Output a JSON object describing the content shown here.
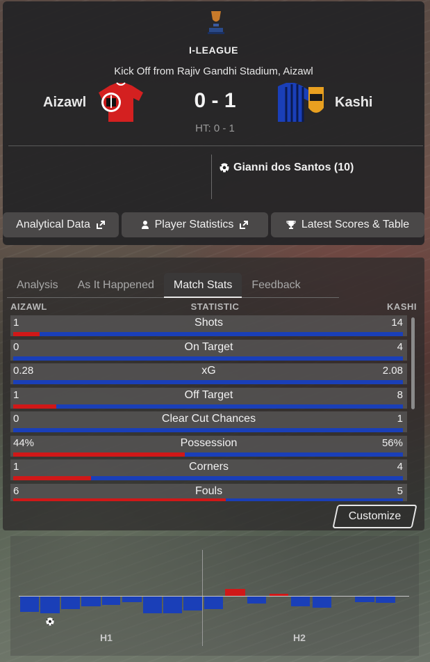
{
  "header": {
    "league": "I-LEAGUE",
    "kickoff": "Kick Off from Rajiv Gandhi Stadium, Aizawl",
    "home_team": "Aizawl",
    "away_team": "Kashi",
    "score": "0 - 1",
    "half_time": "HT: 0 - 1",
    "scorer": "Gianni dos Santos (10)",
    "home_color": "#d01818",
    "away_color": "#1a3fb8"
  },
  "buttons": {
    "analytical": "Analytical Data",
    "player_stats": "Player Statistics",
    "latest_scores": "Latest Scores & Table"
  },
  "tabs": [
    "Analysis",
    "As It Happened",
    "Match Stats",
    "Feedback"
  ],
  "active_tab": "Match Stats",
  "columns": {
    "home": "AIZAWL",
    "stat": "STATISTIC",
    "away": "KASHI"
  },
  "stats": [
    {
      "label": "Shots",
      "home": "1",
      "away": "14",
      "home_share": 0.067
    },
    {
      "label": "On Target",
      "home": "0",
      "away": "4",
      "home_share": 0
    },
    {
      "label": "xG",
      "home": "0.28",
      "away": "2.08",
      "home_share": 0
    },
    {
      "label": "Off Target",
      "home": "1",
      "away": "8",
      "home_share": 0.111
    },
    {
      "label": "Clear Cut Chances",
      "home": "0",
      "away": "1",
      "home_share": 0
    },
    {
      "label": "Possession",
      "home": "44%",
      "away": "56%",
      "home_share": 0.44
    },
    {
      "label": "Corners",
      "home": "1",
      "away": "4",
      "home_share": 0.2
    },
    {
      "label": "Fouls",
      "home": "6",
      "away": "5",
      "home_share": 0.545
    }
  ],
  "customize_label": "Customize",
  "timeline": {
    "half_labels": [
      "H1",
      "H2"
    ],
    "goal_icon": "football-icon"
  }
}
